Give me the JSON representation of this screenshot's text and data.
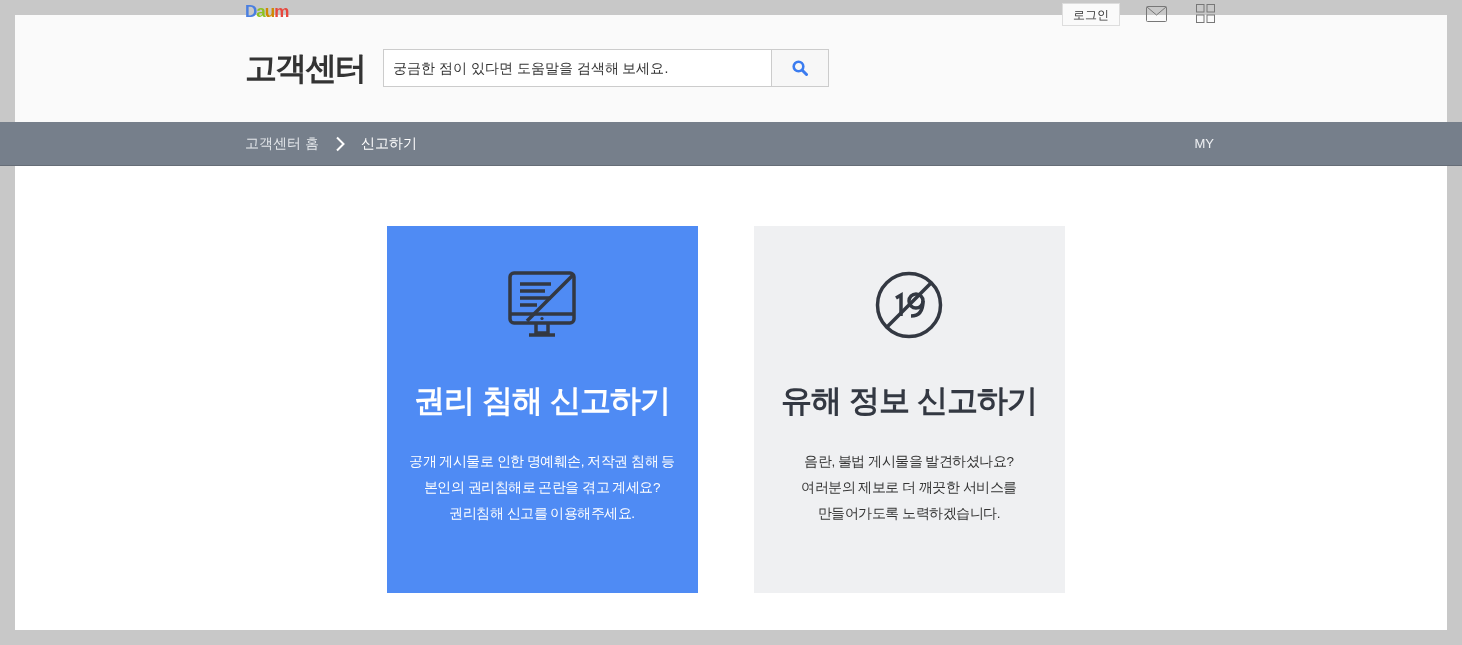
{
  "top_bar": {
    "logo": "Daum",
    "login_button": "로그인"
  },
  "header": {
    "title": "고객센터",
    "search": {
      "placeholder": "궁금한 점이 있다면 도움말을 검색해 보세요."
    }
  },
  "breadcrumb": [
    {
      "label": "고객센터 홈",
      "current": false
    },
    {
      "label": "신고하기",
      "current": true
    }
  ],
  "my_link": "MY",
  "cards": [
    {
      "kind": "rights",
      "title": "권리 침해 신고하기",
      "description": [
        "공개 게시물로 인한 명예훼손, 저작권 침해 등",
        "본인의 권리침해로 곤란을 겪고 계세요?",
        "권리침해 신고를 이용해주세요."
      ]
    },
    {
      "kind": "harmful",
      "title": "유해 정보 신고하기",
      "description": [
        "음란, 불법 게시물을 발견하셨나요?",
        "여러분의 제보로 더 깨끗한 서비스를",
        "만들어가도록 노력하겠습니다."
      ]
    }
  ]
}
